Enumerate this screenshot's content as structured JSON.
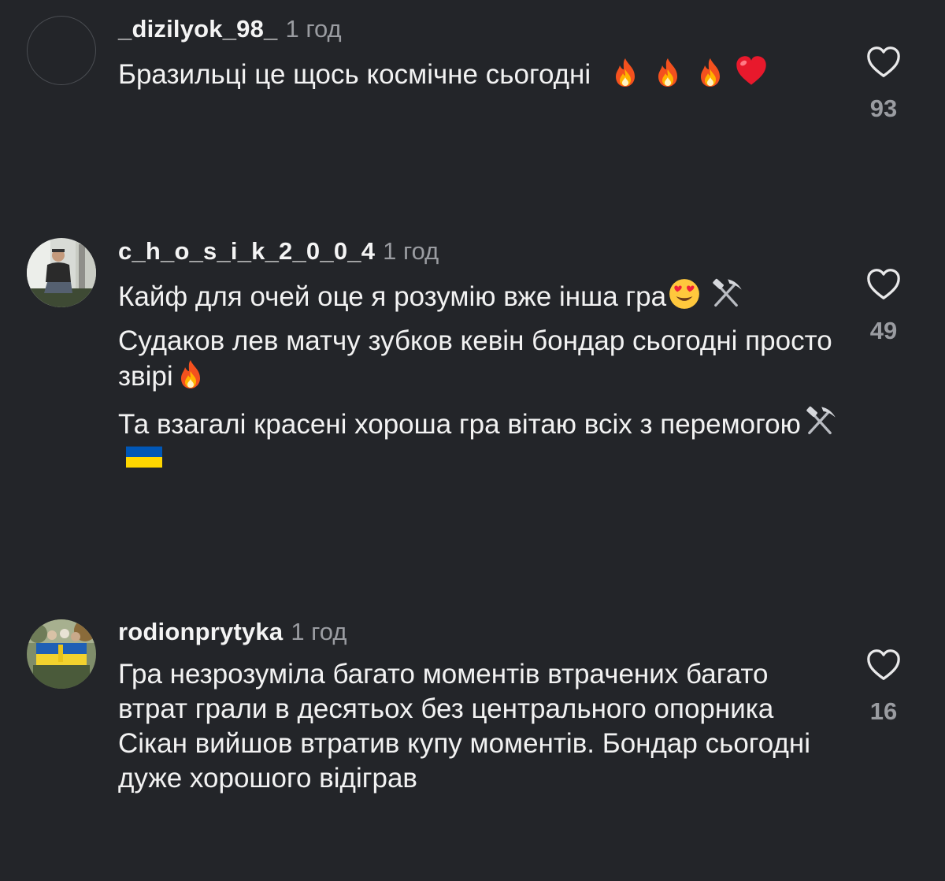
{
  "comments": [
    {
      "username": "_dizilyok_98_",
      "time": "1 год",
      "paragraphs": [
        "Бразильці це щось космічне сьогодні"
      ],
      "likes": "93",
      "avatar": "empty-avatar"
    },
    {
      "username": "c_h_o_s_i_k_2_0_0_4",
      "time": "1 год",
      "paragraphs": [
        "Кайф для очей оце я розумію вже інша гра",
        "Судаков лев матчу зубков кевін бондар сьогодні просто звірі",
        "Та взагалі красені хороша гра вітаю всіх з перемогою"
      ],
      "likes": "49",
      "avatar": "photo-avatar"
    },
    {
      "username": "rodionprytyka",
      "time": "1 год",
      "paragraphs": [
        "Гра незрозуміла багато моментів втрачених багато втрат грали в десятьох без центрального опорника Сікан вийшов втратив купу моментів. Бондар сьогодні дуже хорошого відіграв"
      ],
      "likes": "16",
      "avatar": "photo-avatar"
    }
  ],
  "icons": {
    "like": "heart-outline-icon",
    "fire": "fire-emoji",
    "heart": "red-heart-emoji",
    "heart_eyes": "heart-eyes-emoji",
    "pick": "hammer-and-pick-emoji",
    "flag": "ukraine-flag-emoji"
  },
  "colors": {
    "background": "#232529",
    "text": "#f2f2f2",
    "muted": "#9a9ca1",
    "flag_blue": "#0057b7",
    "flag_yellow": "#ffd700"
  }
}
